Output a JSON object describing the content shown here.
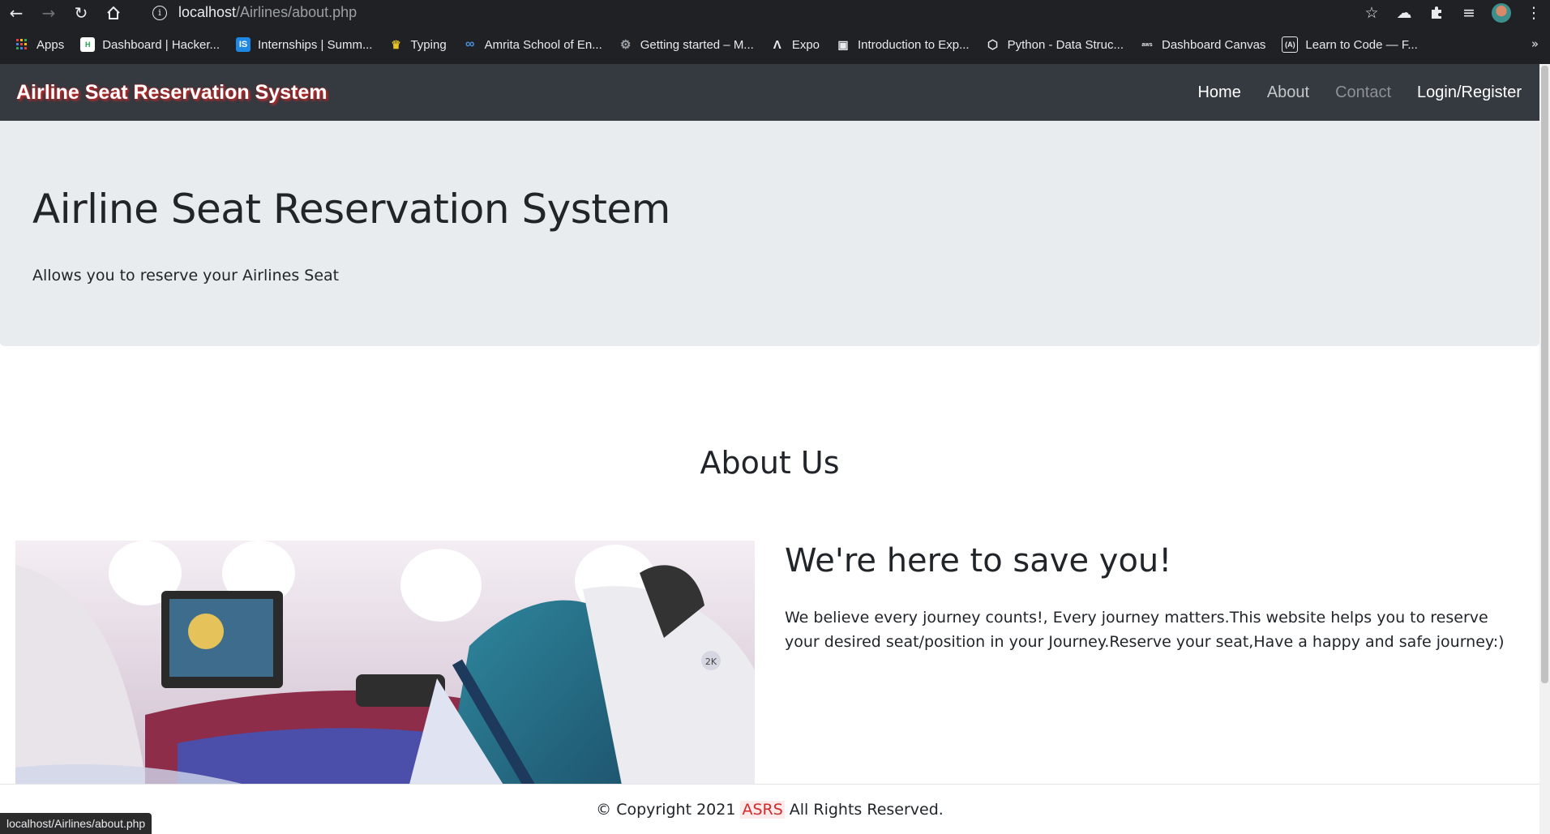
{
  "browser": {
    "url_host": "localhost",
    "url_path": "/Airlines/about.php",
    "status_url": "localhost/Airlines/about.php",
    "bookmarks": [
      {
        "label": "Apps",
        "icon": "apps-grid-icon"
      },
      {
        "label": "Dashboard | Hacker...",
        "icon": "hackerrank-icon"
      },
      {
        "label": "Internships | Summ...",
        "icon": "internshala-icon"
      },
      {
        "label": "Typing",
        "icon": "typing-icon"
      },
      {
        "label": "Amrita School of En...",
        "icon": "link-icon"
      },
      {
        "label": "Getting started – M...",
        "icon": "settings-globe-icon"
      },
      {
        "label": "Expo",
        "icon": "expo-icon"
      },
      {
        "label": "Introduction to Exp...",
        "icon": "openedx-icon"
      },
      {
        "label": "Python - Data Struc...",
        "icon": "hexagon-icon"
      },
      {
        "label": "Dashboard Canvas",
        "icon": "aws-icon"
      },
      {
        "label": "Learn to Code — F...",
        "icon": "freecodecamp-icon"
      }
    ],
    "more_bookmarks": "»"
  },
  "site": {
    "brand": "Airline Seat Reservation System",
    "nav": [
      {
        "label": "Home"
      },
      {
        "label": "About"
      },
      {
        "label": "Contact"
      },
      {
        "label": "Login/Register"
      }
    ]
  },
  "jumbotron": {
    "title": "Airline Seat Reservation System",
    "subtitle": "Allows you to reserve your Airlines Seat"
  },
  "about": {
    "title": "About Us",
    "heading": "We're here to save you!",
    "text": "We believe every journey counts!, Every journey matters.This website helps you to reserve your desired seat/position in your Journey.Reserve your seat,Have a happy and safe journey:)",
    "seat_label": "2K"
  },
  "footer": {
    "prefix": "© Copyright 2021",
    "highlight": "ASRS",
    "suffix": "All Rights Reserved."
  },
  "colors": {
    "navbar": "#343a40",
    "jumbotron": "#e9ecef",
    "brand_shadow": "#d42727",
    "footer_highlight": "#cf2b2b"
  }
}
